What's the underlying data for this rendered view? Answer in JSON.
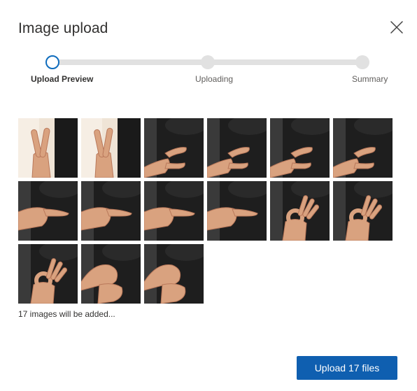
{
  "dialog": {
    "title": "Image upload",
    "close_icon": "close-icon"
  },
  "stepper": {
    "steps": [
      {
        "label": "Upload Preview",
        "state": "active"
      },
      {
        "label": "Uploading",
        "state": "pending"
      },
      {
        "label": "Summary",
        "state": "pending"
      }
    ]
  },
  "preview": {
    "images": [
      {
        "gesture": "peace-sign",
        "background": "light"
      },
      {
        "gesture": "peace-sign",
        "background": "light"
      },
      {
        "gesture": "c-shape",
        "background": "dark"
      },
      {
        "gesture": "c-shape",
        "background": "dark"
      },
      {
        "gesture": "c-shape",
        "background": "dark"
      },
      {
        "gesture": "c-shape",
        "background": "dark"
      },
      {
        "gesture": "pointing",
        "background": "dark"
      },
      {
        "gesture": "pointing",
        "background": "dark"
      },
      {
        "gesture": "pointing",
        "background": "dark"
      },
      {
        "gesture": "pointing",
        "background": "dark"
      },
      {
        "gesture": "ok-sign",
        "background": "dark"
      },
      {
        "gesture": "ok-sign",
        "background": "dark"
      },
      {
        "gesture": "ok-sign",
        "background": "dark"
      },
      {
        "gesture": "fist",
        "background": "dark"
      },
      {
        "gesture": "fist",
        "background": "dark"
      }
    ],
    "count_text": "17 images will be added..."
  },
  "footer": {
    "upload_label": "Upload 17 files"
  },
  "colors": {
    "accent": "#0f6cbd",
    "button": "#0f5fb0",
    "track": "#e1e1e1",
    "text": "#323130",
    "muted": "#605e5c"
  }
}
